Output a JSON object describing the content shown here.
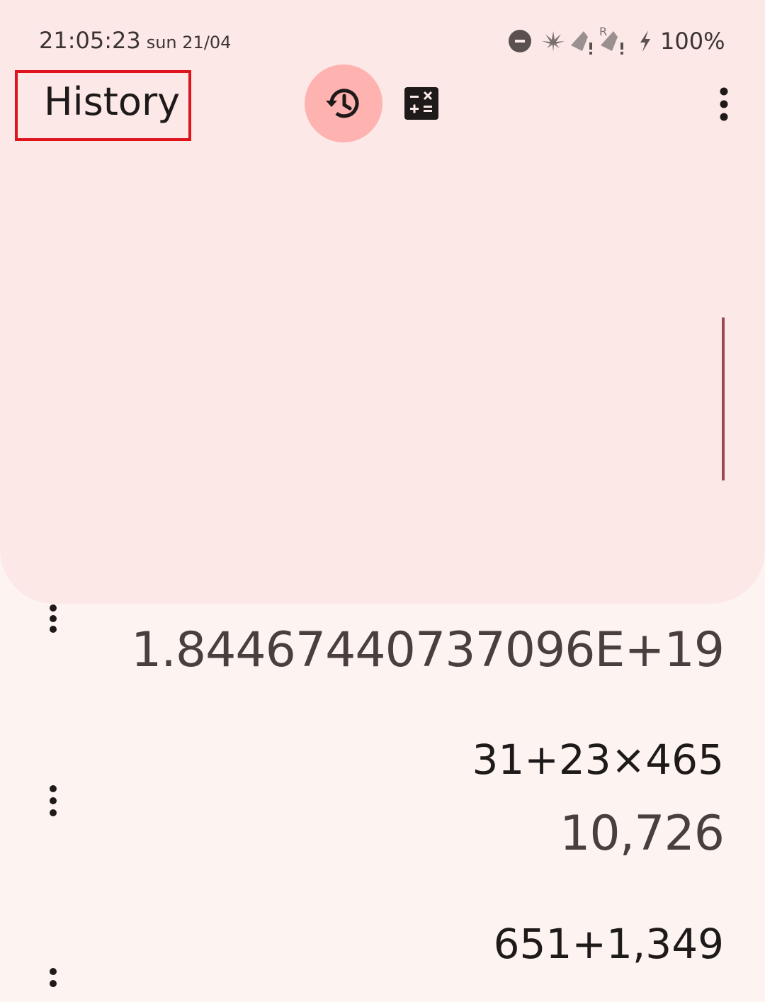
{
  "status_bar": {
    "time": "21:05:23",
    "date": "sun 21/04",
    "battery": "100%",
    "icons": [
      "do-not-disturb-icon",
      "cannabis-leaf-icon",
      "no-signal-icon",
      "roaming-signal-icon",
      "charging-bolt-icon"
    ]
  },
  "header": {
    "title": "History",
    "history_icon": "history-icon",
    "calculator_icon": "calculator-icon",
    "menu_icon": "more-vert-icon"
  },
  "entries": [
    {
      "result": "1.84467440737096E+19"
    },
    {
      "expression": "31+23×465",
      "result": "10,726"
    },
    {
      "expression": "651+1,349"
    }
  ],
  "colors": {
    "top_sheet": "#fce9e7",
    "background": "#fdf4f2",
    "history_active": "#ffb3b1",
    "highlight": "#e0121c",
    "scroll_indicator": "#9a4a52"
  }
}
